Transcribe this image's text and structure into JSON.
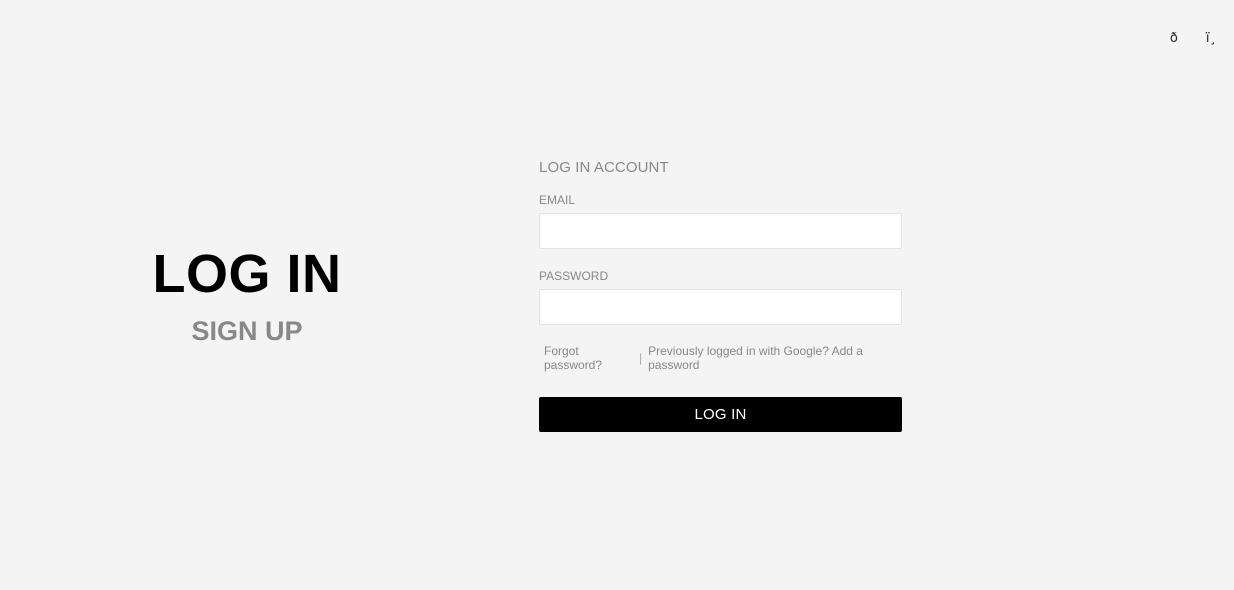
{
  "header": {
    "icons": [
      {
        "name": "account-icon",
        "glyph": "ð"
      },
      {
        "name": "cart-icon",
        "glyph": "ï¸"
      }
    ]
  },
  "switcher": {
    "active_tab": "LOG IN",
    "inactive_tab": "SIGN UP"
  },
  "form": {
    "title": "LOG IN ACCOUNT",
    "email": {
      "label": "EMAIL",
      "value": "",
      "placeholder": ""
    },
    "password": {
      "label": "PASSWORD",
      "value": "",
      "placeholder": ""
    },
    "forgot_link": "Forgot password?",
    "separator": "|",
    "google_link": "Previously logged in with Google? Add a password",
    "submit_label": "LOG IN"
  },
  "colors": {
    "background": "#f4f4f4",
    "primary_button": "#000000",
    "muted_text": "#888888"
  }
}
